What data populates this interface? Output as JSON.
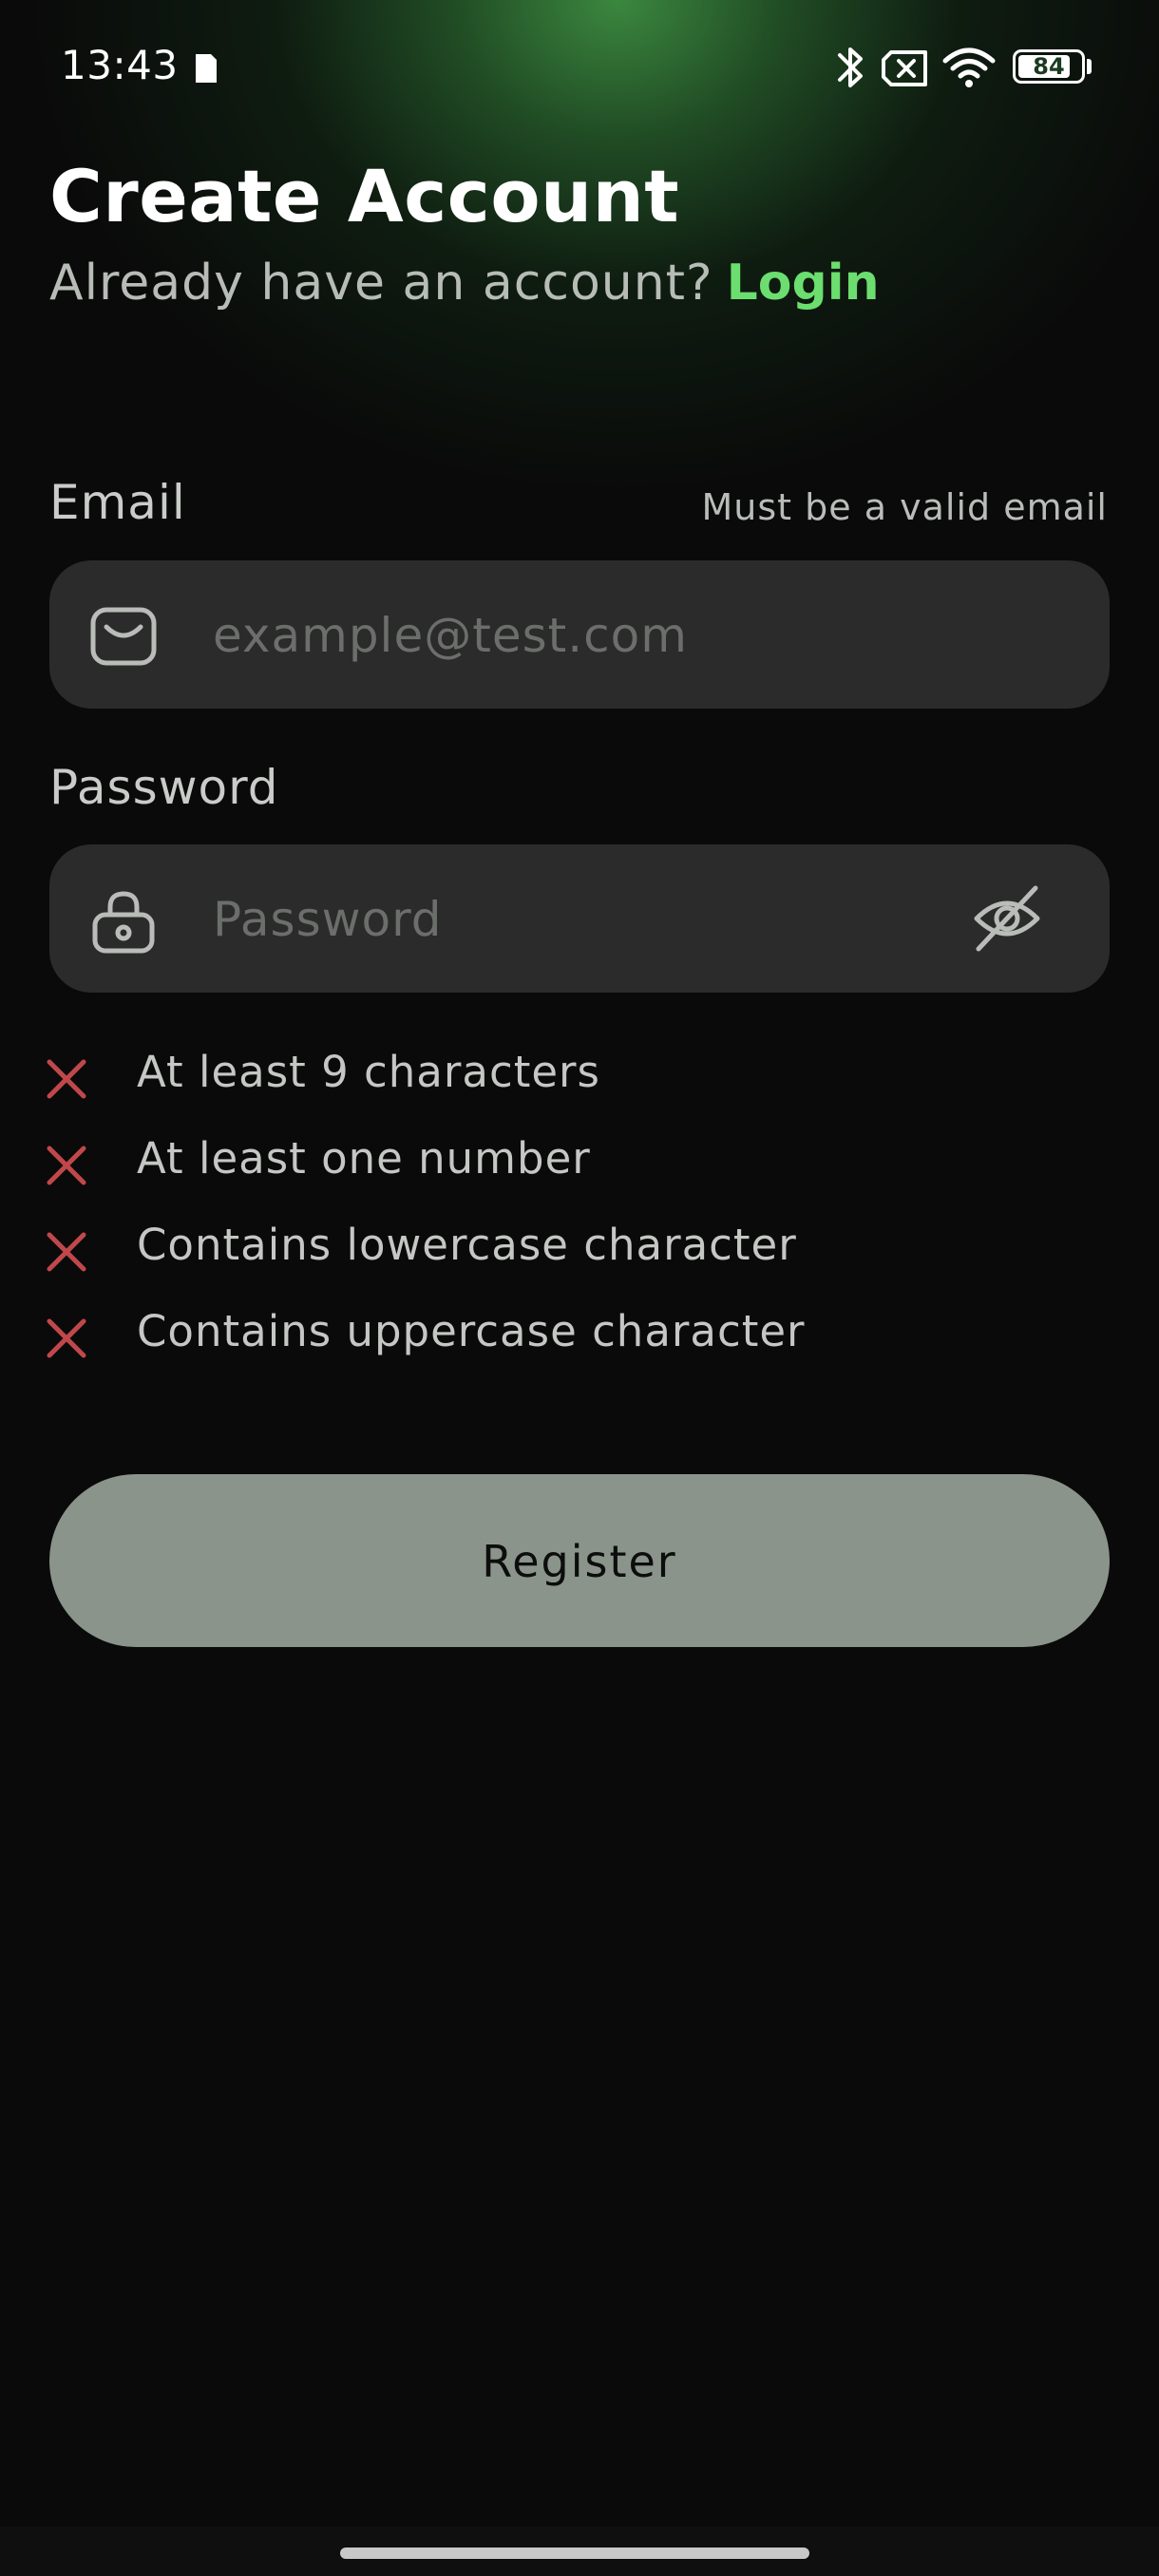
{
  "status_bar": {
    "time": "13:43",
    "battery_level": "84",
    "battery_fraction": 0.84,
    "icons": [
      "sim-card-icon",
      "bluetooth-icon",
      "no-sim-icon",
      "wifi-icon",
      "battery-icon"
    ]
  },
  "header": {
    "title": "Create Account",
    "subtitle": "Already have an account?",
    "login_link": "Login"
  },
  "email": {
    "label": "Email",
    "hint": "Must be a valid email",
    "placeholder": "example@test.com",
    "value": "",
    "icon": "envelope-icon"
  },
  "password": {
    "label": "Password",
    "placeholder": "Password",
    "value": "",
    "icon": "lock-icon",
    "toggle_icon": "eye-off-icon"
  },
  "requirements": [
    {
      "text": "At least 9 characters",
      "met": false
    },
    {
      "text": "At least one number",
      "met": false
    },
    {
      "text": "Contains lowercase character",
      "met": false
    },
    {
      "text": "Contains uppercase character",
      "met": false
    }
  ],
  "register_button": {
    "label": "Register"
  },
  "colors": {
    "accent": "#6bde6f",
    "error": "#c0484a",
    "button": "#8a948b",
    "input_bg": "#2a2b2a",
    "background": "#0a0a0a"
  }
}
